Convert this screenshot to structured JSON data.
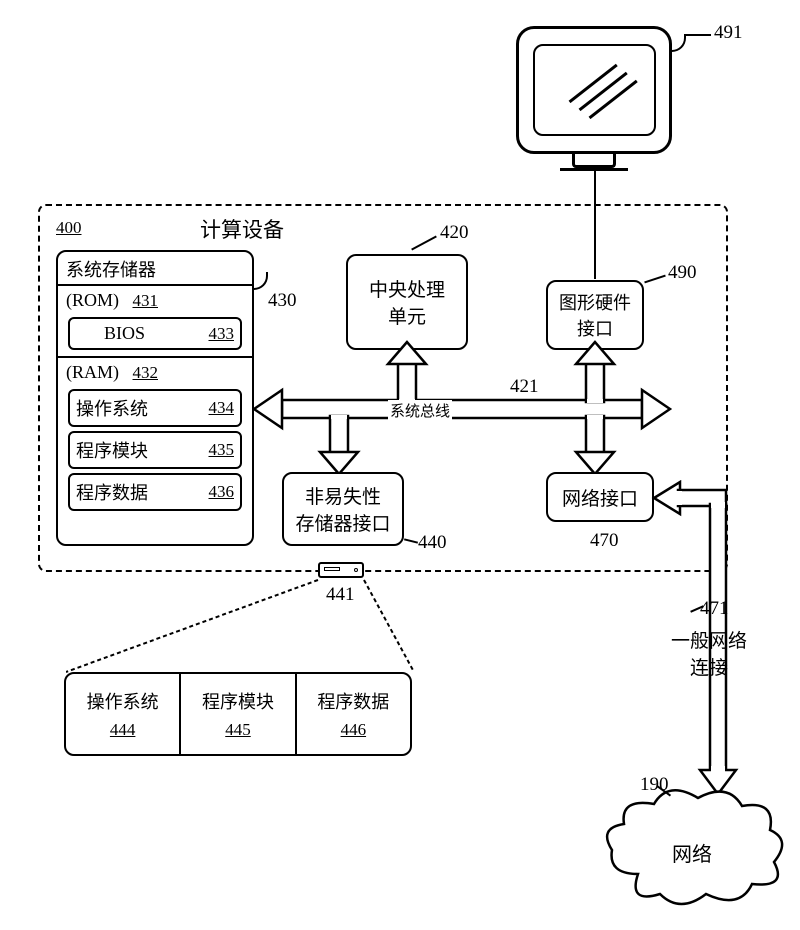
{
  "refs": {
    "device": "400",
    "cpu": "420",
    "bus": "421",
    "mem": "430",
    "rom": "431",
    "ram": "432",
    "bios": "433",
    "os": "434",
    "mods": "435",
    "data": "436",
    "nvif": "440",
    "disk": "441",
    "osD": "444",
    "modsD": "445",
    "dataD": "446",
    "netif": "470",
    "netconn": "471",
    "gfx": "490",
    "monitor": "491",
    "network": "190"
  },
  "labels": {
    "device_title": "计算设备",
    "sysmem": "系统存储器",
    "rom": "(ROM)",
    "ram": "(RAM)",
    "bios": "BIOS",
    "os": "操作系统",
    "mods": "程序模块",
    "data": "程序数据",
    "cpu": "中央处理\n单元",
    "gfx": "图形硬件\n接口",
    "bus": "系统总线",
    "nvif": "非易失性\n存储器接口",
    "netif": "网络接口",
    "netconn": "一般网络\n连接",
    "network": "网络"
  }
}
